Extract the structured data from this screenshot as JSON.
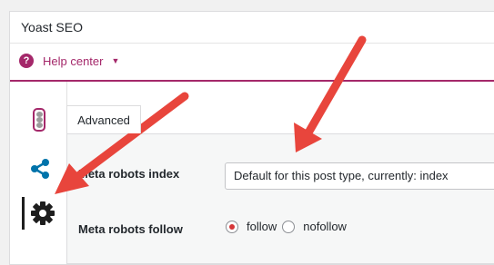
{
  "metabox": {
    "title": "Yoast SEO"
  },
  "help": {
    "label": "Help center",
    "icon": "question-circle-icon",
    "accent": "#a4286a"
  },
  "sidebar": {
    "items": [
      {
        "name": "readability",
        "icon": "traffic-light-icon"
      },
      {
        "name": "social",
        "icon": "share-icon"
      },
      {
        "name": "advanced-settings",
        "icon": "gear-icon",
        "active": true
      }
    ]
  },
  "tabs": [
    {
      "label": "Advanced",
      "active": true
    }
  ],
  "fields": {
    "meta_robots_index": {
      "label": "Meta robots index",
      "value": "Default for this post type, currently: index"
    },
    "meta_robots_follow": {
      "label": "Meta robots follow",
      "options": [
        "follow",
        "nofollow"
      ],
      "selected": "follow"
    }
  },
  "annotations": {
    "arrow_color": "#e8453c"
  }
}
